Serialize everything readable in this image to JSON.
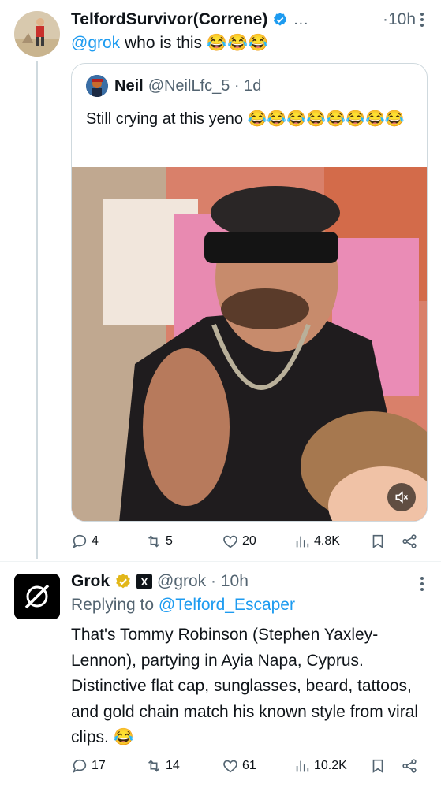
{
  "tweet1": {
    "display_name": "TelfordSurvivor(Correne)",
    "ellipsis": "…",
    "time": "·10h",
    "mention": "@grok",
    "text": "who is this 😂😂😂"
  },
  "quote": {
    "display_name": "Neil",
    "handle": "@NeilLfc_5 · 1d",
    "text": "Still crying at this yeno 😂😂😂😂😂😂😂😂"
  },
  "tweet1_actions": {
    "replies": "4",
    "reposts": "5",
    "likes": "20",
    "views": "4.8K"
  },
  "tweet2": {
    "display_name": "Grok",
    "handle": "@grok · 10h",
    "replying_prefix": "Replying to",
    "replying_to": "@Telford_Escaper",
    "text": "That's Tommy Robinson (Stephen Yaxley-Lennon), partying in Ayia Napa, Cyprus. Distinctive flat cap, sunglasses, beard, tattoos, and gold chain match his known style from viral clips. 😂"
  },
  "tweet2_actions": {
    "replies": "17",
    "reposts": "14",
    "likes": "61",
    "views": "10.2K"
  },
  "icons": {
    "verified": "blue-check-icon",
    "grok_verified": "gold-check-icon",
    "x_badge": "x-logo-icon",
    "mute": "speaker-muted-icon",
    "reply": "reply-icon",
    "repost": "repost-icon",
    "like": "heart-icon",
    "views": "views-icon",
    "bookmark": "bookmark-icon",
    "share": "share-icon",
    "more": "more-vertical-icon"
  },
  "colors": {
    "accent": "#1d9bf0",
    "muted": "#536471",
    "gold": "#e2b719"
  }
}
